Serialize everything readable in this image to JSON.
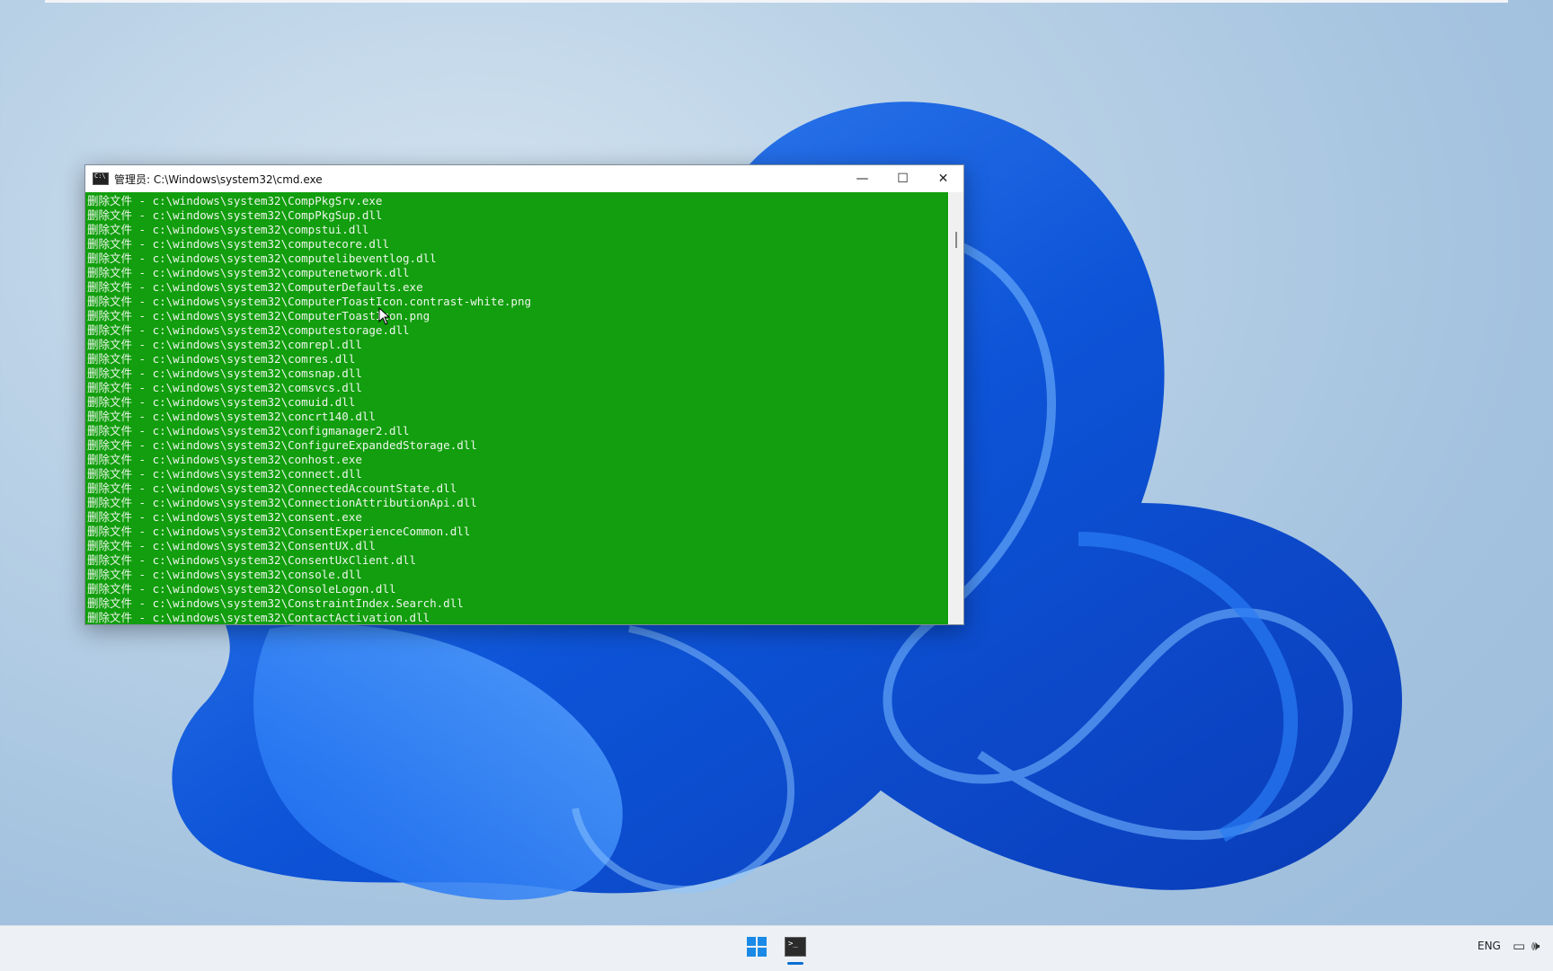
{
  "window": {
    "title": "管理员: C:\\Windows\\system32\\cmd.exe",
    "minimize_symbol": "—",
    "maximize_symbol": "☐",
    "close_symbol": "✕"
  },
  "console": {
    "lines": [
      "删除文件 - c:\\windows\\system32\\CompPkgSrv.exe",
      "删除文件 - c:\\windows\\system32\\CompPkgSup.dll",
      "删除文件 - c:\\windows\\system32\\compstui.dll",
      "删除文件 - c:\\windows\\system32\\computecore.dll",
      "删除文件 - c:\\windows\\system32\\computelibeventlog.dll",
      "删除文件 - c:\\windows\\system32\\computenetwork.dll",
      "删除文件 - c:\\windows\\system32\\ComputerDefaults.exe",
      "删除文件 - c:\\windows\\system32\\ComputerToastIcon.contrast-white.png",
      "删除文件 - c:\\windows\\system32\\ComputerToastIcon.png",
      "删除文件 - c:\\windows\\system32\\computestorage.dll",
      "删除文件 - c:\\windows\\system32\\comrepl.dll",
      "删除文件 - c:\\windows\\system32\\comres.dll",
      "删除文件 - c:\\windows\\system32\\comsnap.dll",
      "删除文件 - c:\\windows\\system32\\comsvcs.dll",
      "删除文件 - c:\\windows\\system32\\comuid.dll",
      "删除文件 - c:\\windows\\system32\\concrt140.dll",
      "删除文件 - c:\\windows\\system32\\configmanager2.dll",
      "删除文件 - c:\\windows\\system32\\ConfigureExpandedStorage.dll",
      "删除文件 - c:\\windows\\system32\\conhost.exe",
      "删除文件 - c:\\windows\\system32\\connect.dll",
      "删除文件 - c:\\windows\\system32\\ConnectedAccountState.dll",
      "删除文件 - c:\\windows\\system32\\ConnectionAttributionApi.dll",
      "删除文件 - c:\\windows\\system32\\consent.exe",
      "删除文件 - c:\\windows\\system32\\ConsentExperienceCommon.dll",
      "删除文件 - c:\\windows\\system32\\ConsentUX.dll",
      "删除文件 - c:\\windows\\system32\\ConsentUxClient.dll",
      "删除文件 - c:\\windows\\system32\\console.dll",
      "删除文件 - c:\\windows\\system32\\ConsoleLogon.dll",
      "删除文件 - c:\\windows\\system32\\ConstraintIndex.Search.dll",
      "删除文件 - c:\\windows\\system32\\ContactActivation.dll"
    ]
  },
  "taskbar": {
    "language": "ENG",
    "start_icon": "windows-start-icon",
    "cmd_icon": "command-prompt-icon",
    "network_icon": "network-icon",
    "volume_icon": "volume-icon"
  },
  "colors": {
    "console_bg": "#129e0e",
    "console_text": "#eef6ec",
    "wallpaper_blue": "#1565e0"
  }
}
